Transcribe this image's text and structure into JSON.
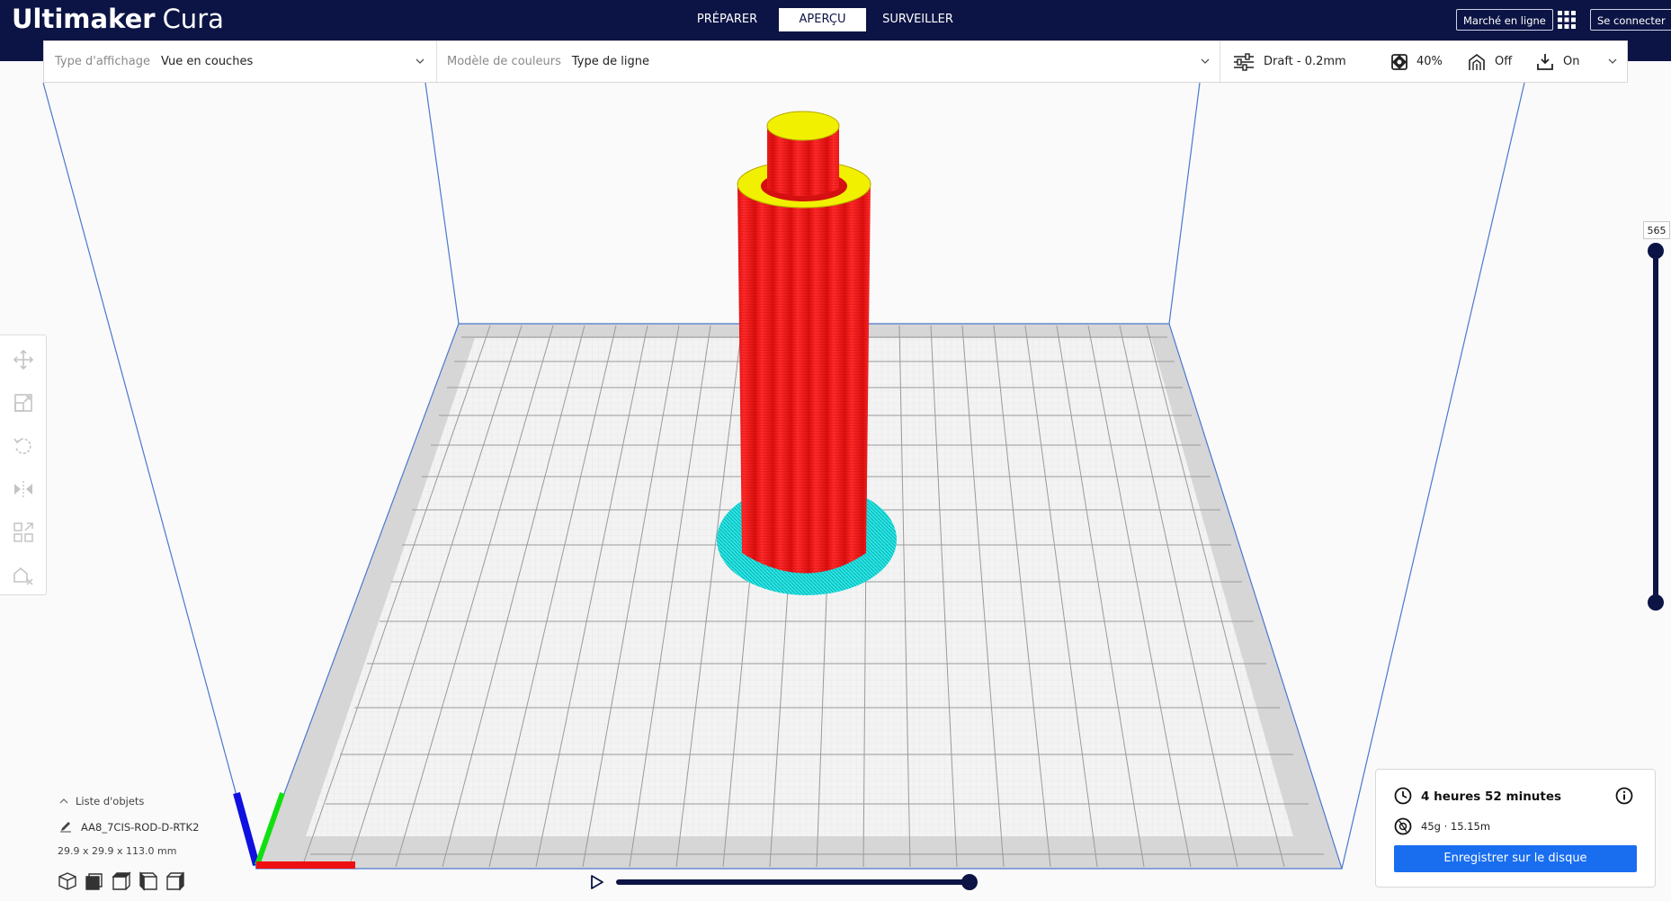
{
  "app": {
    "brand": "Ultimaker",
    "product": "Cura"
  },
  "stages": [
    {
      "label": "PRÉPARER",
      "active": false
    },
    {
      "label": "APERÇU",
      "active": true
    },
    {
      "label": "SURVEILLER",
      "active": false
    }
  ],
  "header": {
    "marketplace_label": "Marché en ligne",
    "signin_label": "Se connecter"
  },
  "view_toolbar": {
    "view_type_label": "Type d'affichage",
    "view_type_value": "Vue en couches",
    "color_scheme_label": "Modèle de couleurs",
    "color_scheme_value": "Type de ligne",
    "profile": "Draft - 0.2mm",
    "infill": "40%",
    "support": "Off",
    "adhesion": "On"
  },
  "layer_slider": {
    "current_layer": "565"
  },
  "object_list": {
    "header_label": "Liste d'objets",
    "items": [
      {
        "name": "AA8_7CIS-ROD-D-RTK2"
      }
    ],
    "dimensions": "29.9 x 29.9 x 113.0 mm"
  },
  "simulation": {
    "progress": 1.0
  },
  "print_info": {
    "time": "4 heures 52 minutes",
    "material": "45g · 15.15m",
    "save_label": "Enregistrer sur le disque"
  },
  "colors": {
    "header_bg": "#0c1445",
    "accent_blue": "#196ef0",
    "wall_red": "#ff1a1a",
    "top_yellow": "#e8f000",
    "skirt_cyan": "#22e8e8"
  },
  "icons": {
    "tools": [
      "move-icon",
      "scale-icon",
      "rotate-icon",
      "mirror-icon",
      "per-model-settings-icon",
      "support-blocker-icon"
    ],
    "camera_views": [
      "3d-view-icon",
      "front-view-icon",
      "top-view-icon",
      "left-view-icon",
      "right-view-icon"
    ]
  }
}
